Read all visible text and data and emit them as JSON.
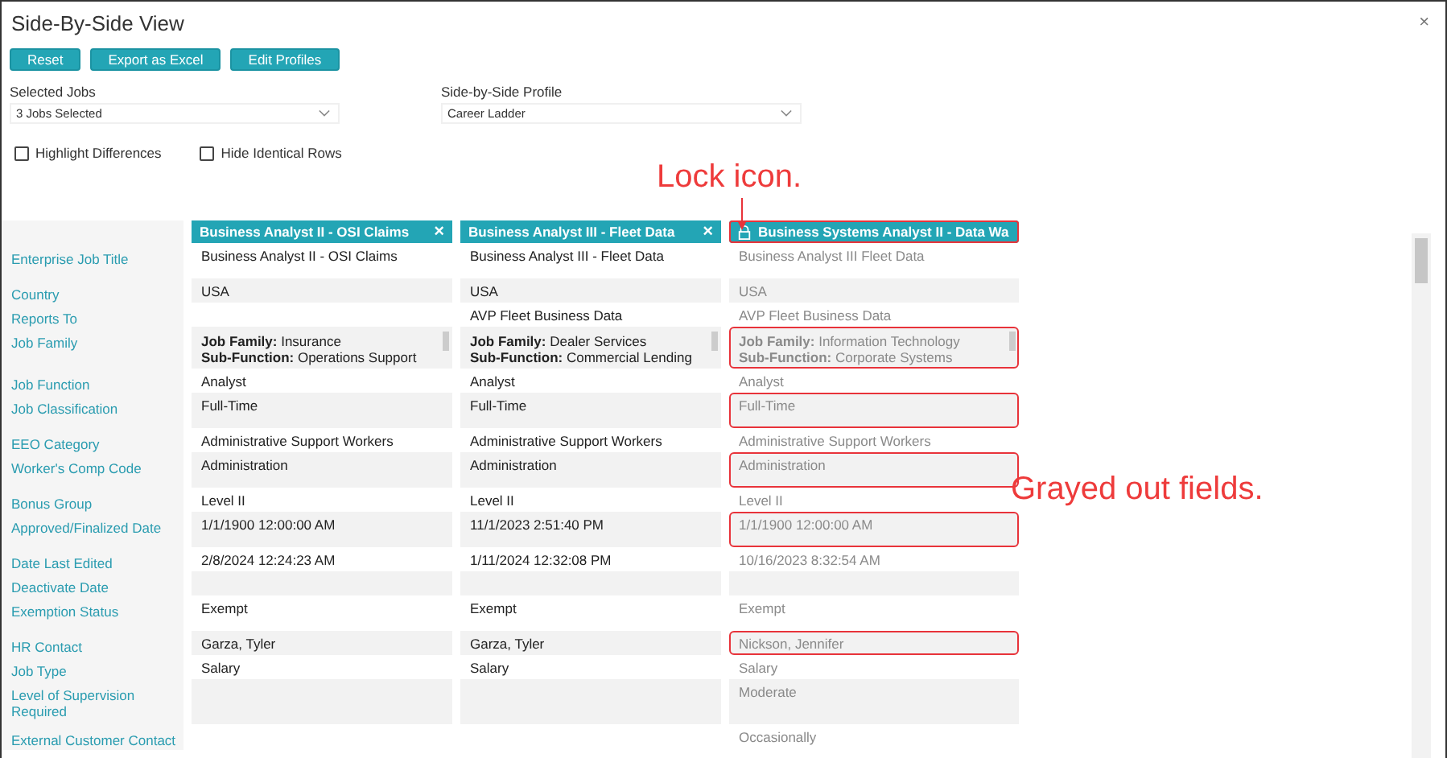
{
  "window": {
    "title": "Side-By-Side View",
    "close": "×"
  },
  "buttons": [
    "Reset",
    "Export as Excel",
    "Edit Profiles"
  ],
  "selected_jobs": {
    "label": "Selected Jobs",
    "value": "3 Jobs Selected"
  },
  "profile": {
    "label": "Side-by-Side Profile",
    "value": "Career Ladder"
  },
  "options": [
    {
      "label": "Highlight Differences",
      "checked": false
    },
    {
      "label": "Hide Identical Rows",
      "checked": false
    }
  ],
  "row_labels": [
    "Enterprise Job Title",
    "Country",
    "Reports To",
    "Job Family",
    "Job Function",
    "Job Classification",
    "EEO Category",
    "Worker's Comp Code",
    "Bonus Group",
    "Approved/Finalized Date",
    "Date Last Edited",
    "Deactivate Date",
    "Exemption Status",
    "HR Contact",
    "Job Type",
    "Level of Supervision Required",
    "External Customer Contact"
  ],
  "jobs": [
    {
      "title": "Business Analyst II - OSI Claims",
      "close": "×",
      "locked": false,
      "grayed": false,
      "outlined": false,
      "cells": [
        {
          "kind": "text",
          "text": "Business Analyst II - OSI Claims",
          "outlined": false
        },
        {
          "kind": "text",
          "text": "USA",
          "outlined": false
        },
        {
          "kind": "empty"
        },
        {
          "kind": "family",
          "lines": [
            "**Job Family:** Insurance",
            "**Sub-Function:** Operations Support"
          ],
          "outlined": false
        },
        {
          "kind": "text",
          "text": "Analyst",
          "outlined": false
        },
        {
          "kind": "text",
          "text": "Full-Time",
          "outlined": false
        },
        {
          "kind": "text",
          "text": "Administrative Support Workers",
          "outlined": false
        },
        {
          "kind": "text",
          "text": "Administration",
          "outlined": false
        },
        {
          "kind": "text",
          "text": "Level II",
          "outlined": false
        },
        {
          "kind": "text",
          "text": "1/1/1900 12:00:00 AM",
          "outlined": false
        },
        {
          "kind": "text",
          "text": "2/8/2024 12:24:23 AM",
          "outlined": false
        },
        {
          "kind": "empty"
        },
        {
          "kind": "text",
          "text": "Exempt",
          "outlined": false
        },
        {
          "kind": "text",
          "text": "Garza, Tyler",
          "outlined": false
        },
        {
          "kind": "text",
          "text": "Salary",
          "outlined": false
        },
        {
          "kind": "empty"
        },
        {
          "kind": "empty"
        }
      ]
    },
    {
      "title": "Business Analyst III - Fleet Data",
      "close": "×",
      "locked": false,
      "grayed": false,
      "outlined": false,
      "cells": [
        {
          "kind": "text",
          "text": "Business Analyst III - Fleet Data",
          "outlined": false
        },
        {
          "kind": "text",
          "text": "USA",
          "outlined": false
        },
        {
          "kind": "text",
          "text": "AVP Fleet Business Data",
          "outlined": false
        },
        {
          "kind": "family",
          "lines": [
            "**Job Family:** Dealer Services",
            "**Sub-Function:** Commercial Lending"
          ],
          "outlined": false
        },
        {
          "kind": "text",
          "text": "Analyst",
          "outlined": false
        },
        {
          "kind": "text",
          "text": "Full-Time",
          "outlined": false
        },
        {
          "kind": "text",
          "text": "Administrative Support Workers",
          "outlined": false
        },
        {
          "kind": "text",
          "text": "Administration",
          "outlined": false
        },
        {
          "kind": "text",
          "text": "Level II",
          "outlined": false
        },
        {
          "kind": "text",
          "text": "11/1/2023 2:51:40 PM",
          "outlined": false
        },
        {
          "kind": "text",
          "text": "1/11/2024 12:32:08 PM",
          "outlined": false
        },
        {
          "kind": "empty"
        },
        {
          "kind": "text",
          "text": "Exempt",
          "outlined": false
        },
        {
          "kind": "text",
          "text": "Garza, Tyler",
          "outlined": false
        },
        {
          "kind": "text",
          "text": "Salary",
          "outlined": false
        },
        {
          "kind": "empty"
        },
        {
          "kind": "empty"
        }
      ]
    },
    {
      "title": "Business Systems Analyst II - Data Wa",
      "locked": true,
      "grayed": true,
      "outlined": true,
      "cells": [
        {
          "kind": "text",
          "text": "Business Analyst III Fleet Data",
          "outlined": false
        },
        {
          "kind": "text",
          "text": "USA",
          "outlined": false
        },
        {
          "kind": "text",
          "text": "AVP Fleet Business Data",
          "outlined": false
        },
        {
          "kind": "family",
          "lines": [
            "**Job Family:** Information Technology",
            "**Sub-Function:** Corporate Systems"
          ],
          "outlined": true
        },
        {
          "kind": "text",
          "text": "Analyst",
          "outlined": false
        },
        {
          "kind": "text",
          "text": "Full-Time",
          "outlined": true
        },
        {
          "kind": "text",
          "text": "Administrative Support Workers",
          "outlined": false
        },
        {
          "kind": "text",
          "text": "Administration",
          "outlined": true
        },
        {
          "kind": "text",
          "text": "Level II",
          "outlined": false
        },
        {
          "kind": "text",
          "text": "1/1/1900 12:00:00 AM",
          "outlined": true
        },
        {
          "kind": "text",
          "text": "10/16/2023 8:32:54 AM",
          "outlined": false
        },
        {
          "kind": "empty"
        },
        {
          "kind": "text",
          "text": "Exempt",
          "outlined": false
        },
        {
          "kind": "text",
          "text": "Nickson, Jennifer",
          "outlined": true
        },
        {
          "kind": "text",
          "text": "Salary",
          "outlined": false
        },
        {
          "kind": "text",
          "text": "Moderate",
          "outlined": false
        },
        {
          "kind": "text",
          "text": "Occasionally",
          "outlined": false
        }
      ]
    }
  ],
  "annotations": [
    {
      "kind": "arrow",
      "text": "Lock icon."
    },
    {
      "kind": "plain",
      "text": "Grayed out fields."
    }
  ]
}
